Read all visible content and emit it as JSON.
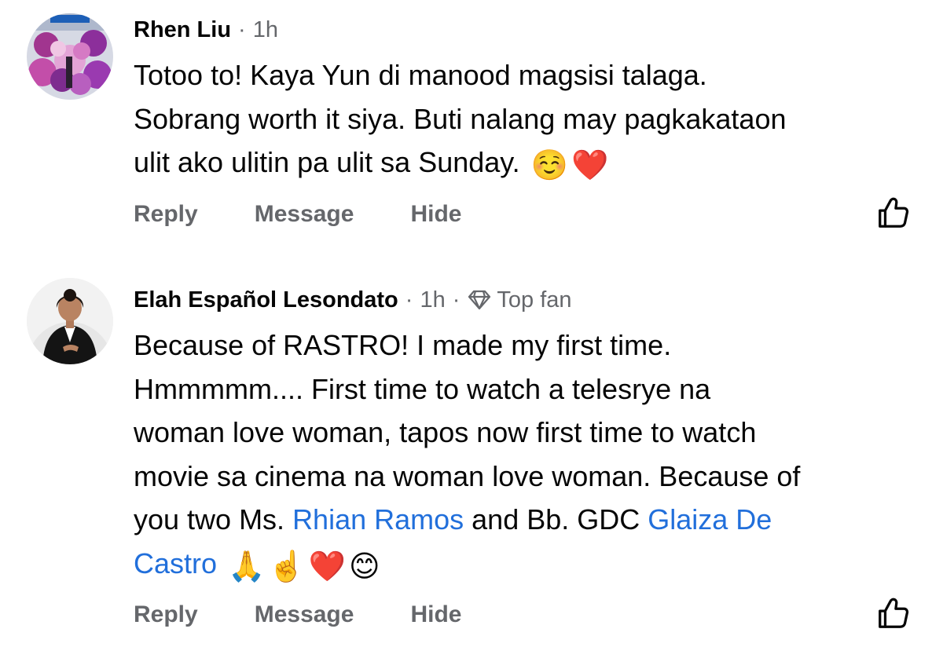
{
  "comments": [
    {
      "author": "Rhen Liu",
      "time": "1h",
      "badge": "",
      "avatar_icon": "avatar-photo-purple-flowers",
      "lines": [
        "Totoo to! Kaya Yun di manood magsisi talaga.",
        "Sobrang worth it siya. Buti nalang may pagkakataon",
        "ulit ako ulitin pa ulit sa Sunday."
      ],
      "emojis": [
        "☺️",
        "❤️"
      ],
      "actions": {
        "reply": "Reply",
        "message": "Message",
        "hide": "Hide"
      }
    },
    {
      "author": "Elah Español Lesondato",
      "time": "1h",
      "badge": "Top fan",
      "avatar_icon": "avatar-photo-woman",
      "lines": [
        "Because of RASTRO! I made my first time.",
        "Hmmmmm.... First time to watch a telesrye na",
        "woman love woman, tapos now first time to watch",
        "movie sa cinema na woman love woman. Because of"
      ],
      "line5_prefix": "you two Ms. ",
      "mention_1": "Rhian Ramos",
      "line5_middle": " and Bb. GDC ",
      "mention_2_part1": "Glaiza De",
      "mention_2_part2": "Castro",
      "emojis": [
        "🙏",
        "☝️",
        "❤️",
        "😊"
      ],
      "actions": {
        "reply": "Reply",
        "message": "Message",
        "hide": "Hide"
      }
    }
  ],
  "colors": {
    "text": "#050505",
    "secondary": "#65676b",
    "mention": "#216fdb",
    "background": "#ffffff"
  },
  "icons": {
    "like": "thumbs-up-outline-icon",
    "badge": "diamond-icon"
  }
}
